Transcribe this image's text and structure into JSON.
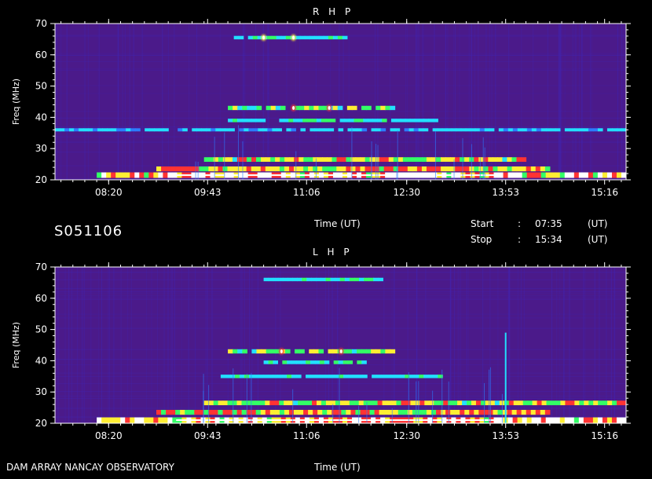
{
  "colors": {
    "background": "#000000",
    "spectro_base": "#4b1a8a",
    "spectro_mid": "#3a2ccf",
    "emission_blue": "#2c7cff",
    "emission_cyan": "#22e0ff",
    "emission_green": "#33ff66",
    "emission_yellow": "#ffee33",
    "emission_red": "#ff3333",
    "emission_white": "#ffffff"
  },
  "labels": {
    "id": "S051106",
    "time_axis": "Time (UT)",
    "start_label": "Start",
    "stop_label": "Stop",
    "colon": ":",
    "start_time": "07:35",
    "stop_time": "15:34",
    "ut_unit": "(UT)",
    "footer": "DAM ARRAY   NANCAY OBSERVATORY"
  },
  "chart_data": [
    {
      "type": "heatmap",
      "title": "R H P",
      "xlabel": "Time (UT)",
      "ylabel": "Freq (MHz)",
      "ylim": [
        20,
        70
      ],
      "xlim": [
        "07:35",
        "15:34"
      ],
      "x_ticks": [
        "08:20",
        "09:43",
        "11:06",
        "12:30",
        "13:53",
        "15:16"
      ],
      "y_ticks": [
        20,
        30,
        40,
        50,
        60,
        70
      ],
      "grid": false,
      "features": [
        {
          "kind": "band",
          "freq": 21.5,
          "start": "08:10",
          "end": "15:34",
          "intensity": 1.0
        },
        {
          "kind": "band",
          "freq": 23.5,
          "start": "09:00",
          "end": "14:30",
          "intensity": 0.8
        },
        {
          "kind": "band",
          "freq": 26.5,
          "start": "09:40",
          "end": "14:10",
          "intensity": 0.7
        },
        {
          "kind": "band",
          "freq": 43.0,
          "start": "10:00",
          "end": "12:20",
          "intensity": 0.6
        },
        {
          "kind": "band",
          "freq": 36.0,
          "start": "07:35",
          "end": "15:34",
          "intensity": 0.25
        },
        {
          "kind": "band",
          "freq": 39.0,
          "start": "10:00",
          "end": "13:00",
          "intensity": 0.35
        },
        {
          "kind": "band",
          "freq": 65.5,
          "start": "10:05",
          "end": "11:40",
          "intensity": 0.35
        },
        {
          "kind": "spot",
          "freq": 65.5,
          "time": "10:30",
          "intensity": 0.7
        },
        {
          "kind": "spot",
          "freq": 65.5,
          "time": "10:55",
          "intensity": 0.7
        },
        {
          "kind": "spot",
          "freq": 43.0,
          "time": "10:55",
          "intensity": 0.9
        },
        {
          "kind": "spot",
          "freq": 43.0,
          "time": "11:25",
          "intensity": 0.8
        }
      ]
    },
    {
      "type": "heatmap",
      "title": "L H P",
      "xlabel": "Time (UT)",
      "ylabel": "Freq (MHz)",
      "ylim": [
        20,
        70
      ],
      "xlim": [
        "07:35",
        "15:34"
      ],
      "x_ticks": [
        "08:20",
        "09:43",
        "11:06",
        "12:30",
        "13:53",
        "15:16"
      ],
      "y_ticks": [
        20,
        30,
        40,
        50,
        60,
        70
      ],
      "grid": false,
      "features": [
        {
          "kind": "band",
          "freq": 21.0,
          "start": "08:10",
          "end": "15:34",
          "intensity": 1.0
        },
        {
          "kind": "band",
          "freq": 23.5,
          "start": "09:00",
          "end": "14:30",
          "intensity": 0.8
        },
        {
          "kind": "band",
          "freq": 26.5,
          "start": "09:40",
          "end": "15:34",
          "intensity": 0.7
        },
        {
          "kind": "band",
          "freq": 43.0,
          "start": "10:00",
          "end": "12:20",
          "intensity": 0.6
        },
        {
          "kind": "band",
          "freq": 39.5,
          "start": "10:30",
          "end": "12:00",
          "intensity": 0.4
        },
        {
          "kind": "band",
          "freq": 35.0,
          "start": "09:50",
          "end": "13:00",
          "intensity": 0.35
        },
        {
          "kind": "band",
          "freq": 66.0,
          "start": "10:30",
          "end": "12:10",
          "intensity": 0.35
        },
        {
          "kind": "vline",
          "time": "13:53",
          "fmin": 20,
          "fmax": 49,
          "intensity": 0.8
        },
        {
          "kind": "spot",
          "freq": 43.0,
          "time": "10:45",
          "intensity": 0.8
        },
        {
          "kind": "spot",
          "freq": 43.0,
          "time": "11:35",
          "intensity": 0.8
        }
      ]
    }
  ]
}
